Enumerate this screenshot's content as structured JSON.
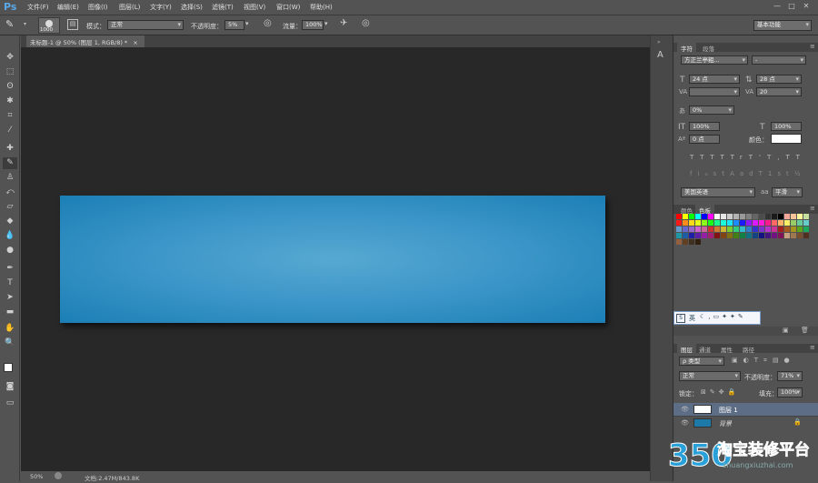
{
  "app": {
    "logo": "Ps"
  },
  "menu": [
    "文件(F)",
    "编辑(E)",
    "图像(I)",
    "图层(L)",
    "文字(Y)",
    "选择(S)",
    "滤镜(T)",
    "视图(V)",
    "窗口(W)",
    "帮助(H)"
  ],
  "window_controls": [
    "—",
    "□",
    "✕"
  ],
  "options": {
    "brush_size": "1000",
    "mode_label": "模式：",
    "mode_value": "正常",
    "opacity_label": "不透明度：",
    "opacity_value": "5%",
    "flow_label": "流量：",
    "flow_value": "100%",
    "workspace": "基本功能"
  },
  "document": {
    "tab_title": "未标题-1 @ 50% (图层 1, RGB/8) *",
    "close": "×"
  },
  "statusbar": {
    "zoom": "50%",
    "doc_info": "文档:2.47M/843.8K"
  },
  "character_panel": {
    "tabs": [
      "字符",
      "段落"
    ],
    "font_family": "方正兰亭粗...",
    "font_style": "-",
    "font_size": "24 点",
    "leading": "28 点",
    "kerning": "",
    "tracking": "20",
    "tsume": "0%",
    "vertical_scale": "100%",
    "horizontal_scale": "100%",
    "baseline": "0 点",
    "color_label": "颜色：",
    "style_buttons": [
      "T",
      "T",
      "TT",
      "Tr",
      "T'",
      "T,",
      "T",
      "T"
    ],
    "ot_buttons": [
      "fi",
      "ℴ",
      "st",
      "A",
      "ad",
      "T",
      "1st",
      "½"
    ],
    "language": "美国英语",
    "antialias": "平滑"
  },
  "swatches_panel": {
    "tabs": [
      "颜色",
      "色板"
    ],
    "colors": [
      "#ff0000",
      "#ffff00",
      "#00ff00",
      "#00ffff",
      "#0000ff",
      "#ff00ff",
      "#ffffff",
      "#e6e6e6",
      "#cccccc",
      "#b3b3b3",
      "#999999",
      "#808080",
      "#666666",
      "#4d4d4d",
      "#333333",
      "#1a1a1a",
      "#000000",
      "#f4a89a",
      "#f7c49a",
      "#fff59a",
      "#c6df9c",
      "#ff1a1a",
      "#ff8c1a",
      "#ffd91a",
      "#e6ff1a",
      "#8cff1a",
      "#1aff1a",
      "#1aff8c",
      "#1affd9",
      "#1ae6ff",
      "#1a8cff",
      "#1a1aff",
      "#8c1aff",
      "#d91aff",
      "#ff1ad9",
      "#ff1a8c",
      "#ff6666",
      "#ffb366",
      "#fff066",
      "#99cc66",
      "#66cc99",
      "#66cccc",
      "#6699cc",
      "#6666cc",
      "#9966cc",
      "#cc66cc",
      "#cc6699",
      "#cc3333",
      "#cc7a33",
      "#ccb833",
      "#7acc33",
      "#33cc7a",
      "#33b8cc",
      "#337acc",
      "#3333cc",
      "#7a33cc",
      "#b833cc",
      "#cc3399",
      "#a61e1e",
      "#a65c1e",
      "#a6961e",
      "#5ca61e",
      "#1ea65c",
      "#1e96a6",
      "#1e5ca6",
      "#1e1ea6",
      "#5c1ea6",
      "#961ea6",
      "#a61e73",
      "#801313",
      "#804313",
      "#807013",
      "#438013",
      "#138043",
      "#137080",
      "#134380",
      "#131380",
      "#431380",
      "#701380",
      "#801356",
      "#c8a080",
      "#a07850",
      "#785030",
      "#503020",
      "#906040",
      "#604020",
      "#403020",
      "#302010"
    ]
  },
  "ime": {
    "label": "英"
  },
  "layers_panel": {
    "tabs": [
      "图层",
      "通道",
      "属性",
      "路径"
    ],
    "filter": "ρ 类型",
    "blend_mode": "正常",
    "opacity_label": "不透明度：",
    "opacity_value": "71%",
    "lock_label": "锁定：",
    "fill_label": "填充：",
    "fill_value": "100%",
    "layers": [
      {
        "name": "图层 1"
      },
      {
        "name": "背景"
      }
    ]
  },
  "watermark": {
    "number": "350",
    "brand": "淘宝装修平台",
    "url": "zhuangxiuzhai.com"
  }
}
